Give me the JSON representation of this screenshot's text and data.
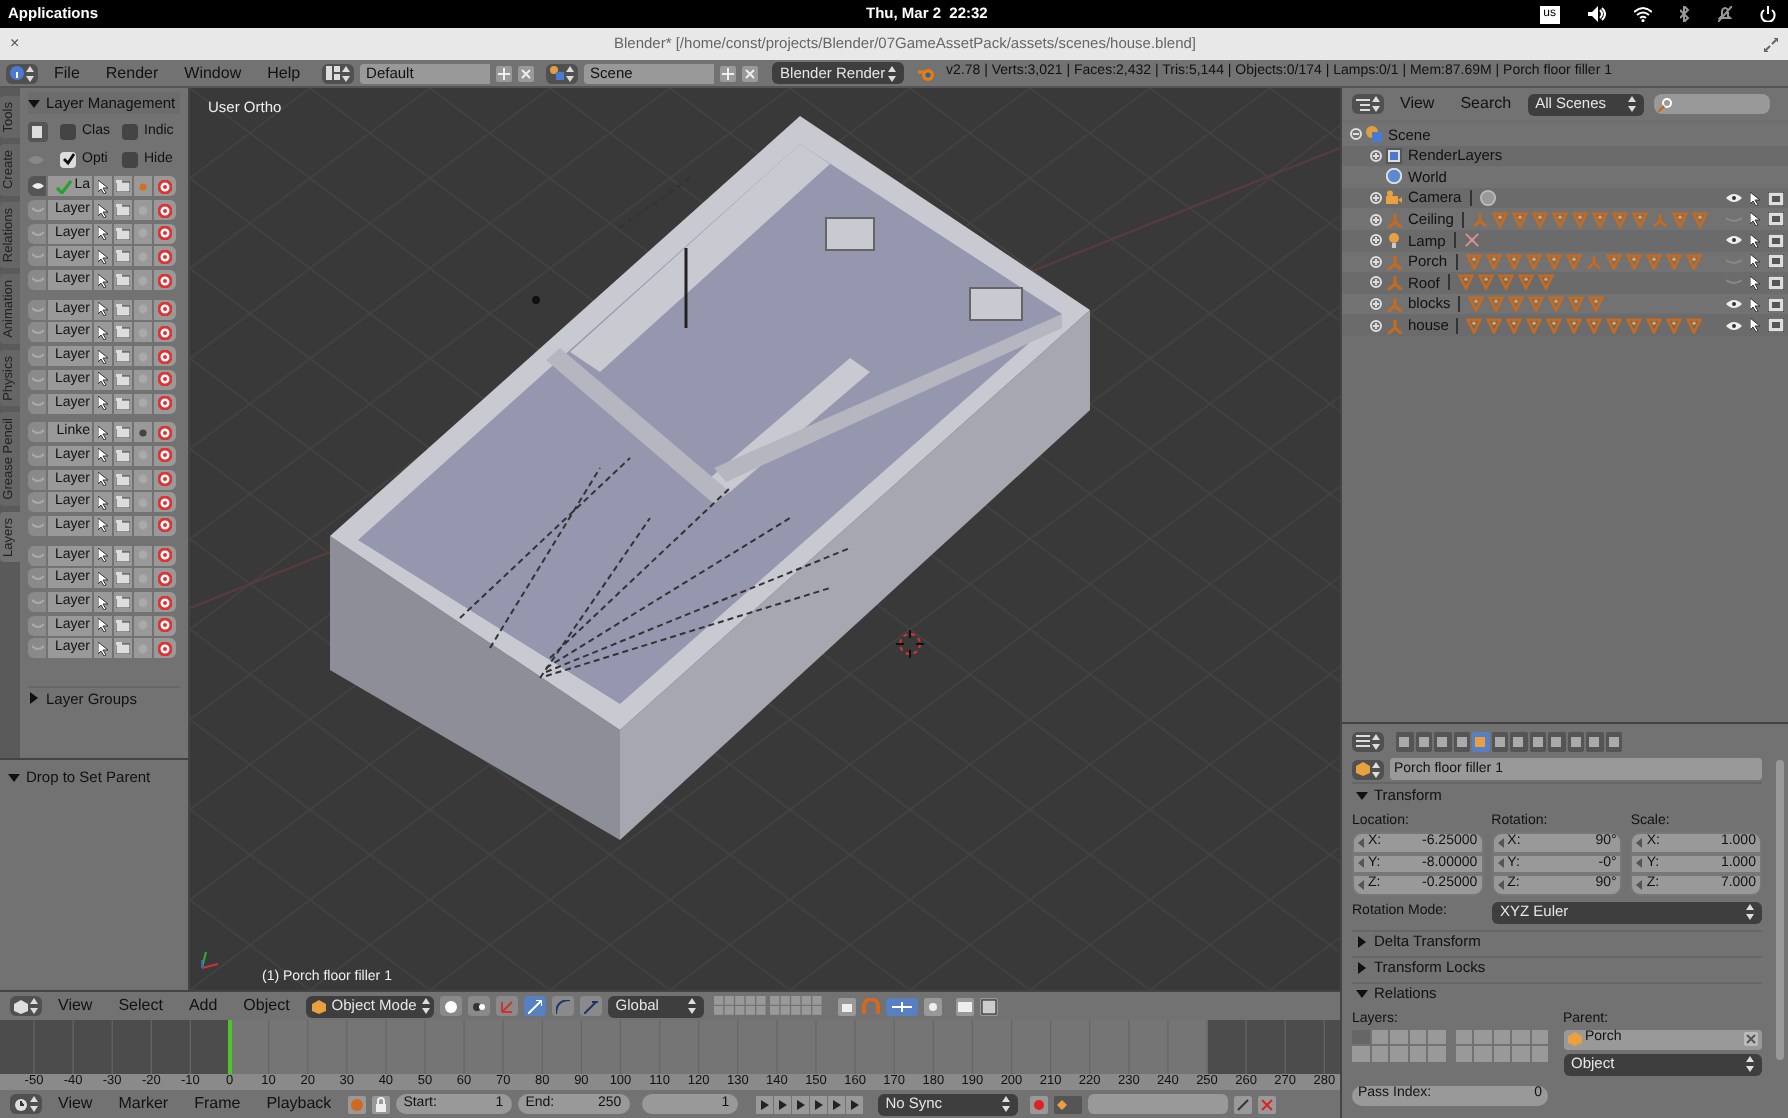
{
  "system_bar": {
    "menu": "Applications",
    "clock": "Thu, Mar 2  22:32",
    "keyboard": "us"
  },
  "window": {
    "close": "×",
    "title": "Blender* [/home/const/projects/Blender/07GameAssetPack/assets/scenes/house.blend]"
  },
  "info_header": {
    "menus": [
      "File",
      "Render",
      "Window",
      "Help"
    ],
    "screen": "Default",
    "scene": "Scene",
    "engine": "Blender Render",
    "stats": "v2.78 | Verts:3,021 | Faces:2,432 | Tris:5,144 | Objects:0/174 | Lamps:0/1 | Mem:87.69M | Porch floor filler 1"
  },
  "tool_tabs": [
    {
      "label": "Tools",
      "selected": false
    },
    {
      "label": "Create",
      "selected": false
    },
    {
      "label": "Relations",
      "selected": false
    },
    {
      "label": "Animation",
      "selected": false
    },
    {
      "label": "Physics",
      "selected": false
    },
    {
      "label": "Grease Pencil",
      "selected": false
    },
    {
      "label": "Layers",
      "selected": true
    }
  ],
  "layer_management": {
    "title": "Layer Management",
    "expanded": true,
    "toggles": [
      {
        "label": "Clas",
        "checked": false
      },
      {
        "label": "Indic",
        "checked": false
      },
      {
        "label": "Opti",
        "checked": true
      },
      {
        "label": "Hide",
        "checked": false
      }
    ],
    "groups": [
      [
        {
          "label": "La",
          "active": true,
          "marked": true
        },
        {
          "label": "Layer",
          "active": false,
          "marked": false
        },
        {
          "label": "Layer",
          "active": false,
          "marked": false
        },
        {
          "label": "Layer",
          "active": false,
          "marked": false
        },
        {
          "label": "Layer",
          "active": false,
          "marked": false
        }
      ],
      [
        {
          "label": "Layer",
          "active": false,
          "marked": false
        },
        {
          "label": "Layer",
          "active": false,
          "marked": false
        },
        {
          "label": "Layer",
          "active": false,
          "marked": false
        },
        {
          "label": "Layer",
          "active": false,
          "marked": false
        },
        {
          "label": "Layer",
          "active": false,
          "marked": false
        }
      ],
      [
        {
          "label": "Linke",
          "active": false,
          "marked": true
        },
        {
          "label": "Layer",
          "active": false,
          "marked": false
        },
        {
          "label": "Layer",
          "active": false,
          "marked": false
        },
        {
          "label": "Layer",
          "active": false,
          "marked": false
        },
        {
          "label": "Layer",
          "active": false,
          "marked": false
        }
      ],
      [
        {
          "label": "Layer",
          "active": false,
          "marked": false
        },
        {
          "label": "Layer",
          "active": false,
          "marked": false
        },
        {
          "label": "Layer",
          "active": false,
          "marked": false
        },
        {
          "label": "Layer",
          "active": false,
          "marked": false
        },
        {
          "label": "Layer",
          "active": false,
          "marked": false
        }
      ]
    ]
  },
  "layer_groups": {
    "title": "Layer Groups",
    "expanded": false
  },
  "drop_panel": {
    "title": "Drop to Set Parent",
    "expanded": true
  },
  "viewport": {
    "view_label": "User Ortho",
    "object_label": "(1) Porch floor filler 1"
  },
  "viewport_header": {
    "menus": [
      "View",
      "Select",
      "Add",
      "Object"
    ],
    "mode": "Object Mode",
    "orientation": "Global"
  },
  "timeline": {
    "ruler": [
      "-50",
      "-40",
      "-30",
      "-20",
      "-10",
      "0",
      "10",
      "20",
      "30",
      "40",
      "50",
      "60",
      "70",
      "80",
      "90",
      "100",
      "110",
      "120",
      "130",
      "140",
      "150",
      "160",
      "170",
      "180",
      "190",
      "200",
      "210",
      "220",
      "230",
      "240",
      "250",
      "260",
      "270",
      "280"
    ],
    "playhead": {
      "level": 0.152
    }
  },
  "timeline_header": {
    "menus": [
      "View",
      "Marker",
      "Frame",
      "Playback"
    ],
    "start_label": "Start:",
    "start": "1",
    "end_label": "End:",
    "end": "250",
    "frame": "1",
    "sync": "No Sync"
  },
  "outliner": {
    "menus": [
      "View",
      "Search"
    ],
    "filter": "All Scenes",
    "tree": [
      {
        "label": "Scene",
        "kind": "scene",
        "expanded": true,
        "children": [
          {
            "label": "RenderLayers",
            "kind": "renderlayers"
          },
          {
            "label": "World",
            "kind": "world"
          },
          {
            "label": "Camera",
            "kind": "camera",
            "visible": true,
            "data": [
              {
                "kind": "camera"
              }
            ]
          },
          {
            "label": "Ceiling",
            "kind": "empty",
            "visible": false,
            "data": [
              {
                "kind": "empty"
              },
              {
                "kind": "mesh"
              },
              {
                "kind": "mesh"
              },
              {
                "kind": "mesh"
              },
              {
                "kind": "mesh"
              },
              {
                "kind": "mesh"
              },
              {
                "kind": "mesh"
              },
              {
                "kind": "mesh"
              },
              {
                "kind": "mesh"
              },
              {
                "kind": "empty"
              },
              {
                "kind": "mesh"
              },
              {
                "kind": "mesh"
              }
            ]
          },
          {
            "label": "Lamp",
            "kind": "lamp",
            "visible": true,
            "data": [
              {
                "kind": "lamp"
              }
            ]
          },
          {
            "label": "Porch",
            "kind": "empty",
            "visible": false,
            "data": [
              {
                "kind": "mesh"
              },
              {
                "kind": "mesh"
              },
              {
                "kind": "mesh"
              },
              {
                "kind": "mesh"
              },
              {
                "kind": "mesh"
              },
              {
                "kind": "mesh"
              },
              {
                "kind": "empty"
              },
              {
                "kind": "mesh"
              },
              {
                "kind": "mesh"
              },
              {
                "kind": "mesh"
              },
              {
                "kind": "mesh"
              },
              {
                "kind": "mesh"
              }
            ]
          },
          {
            "label": "Roof",
            "kind": "empty",
            "visible": false,
            "data": [
              {
                "kind": "mesh"
              },
              {
                "kind": "mesh"
              },
              {
                "kind": "mesh"
              },
              {
                "kind": "mesh"
              },
              {
                "kind": "mesh"
              }
            ]
          },
          {
            "label": "blocks",
            "kind": "empty",
            "visible": true,
            "data": [
              {
                "kind": "mesh"
              },
              {
                "kind": "mesh"
              },
              {
                "kind": "mesh"
              },
              {
                "kind": "mesh"
              },
              {
                "kind": "mesh"
              },
              {
                "kind": "mesh"
              },
              {
                "kind": "mesh"
              }
            ]
          },
          {
            "label": "house",
            "kind": "empty",
            "visible": true,
            "data": [
              {
                "kind": "mesh"
              },
              {
                "kind": "mesh"
              },
              {
                "kind": "mesh"
              },
              {
                "kind": "mesh"
              },
              {
                "kind": "mesh"
              },
              {
                "kind": "mesh"
              },
              {
                "kind": "mesh"
              },
              {
                "kind": "mesh"
              },
              {
                "kind": "mesh"
              },
              {
                "kind": "mesh"
              },
              {
                "kind": "mesh"
              },
              {
                "kind": "mesh"
              }
            ]
          }
        ]
      }
    ]
  },
  "properties": {
    "context_tabs": [
      {
        "selected": false
      },
      {
        "selected": false
      },
      {
        "selected": false
      },
      {
        "selected": false
      },
      {
        "selected": true
      },
      {
        "selected": false
      },
      {
        "selected": false
      },
      {
        "selected": false
      },
      {
        "selected": false
      },
      {
        "selected": false
      },
      {
        "selected": false
      },
      {
        "selected": false
      }
    ],
    "object_name": "Porch floor filler 1",
    "panels": [
      {
        "title": "Transform",
        "kind": "transform",
        "expanded": true,
        "location_label": "Location:",
        "rotation_label": "Rotation:",
        "scale_label": "Scale:",
        "location": [
          {
            "axis": "X:",
            "value": "-6.25000"
          },
          {
            "axis": "Y:",
            "value": "-8.00000"
          },
          {
            "axis": "Z:",
            "value": "-0.25000"
          }
        ],
        "rotation": [
          {
            "axis": "X:",
            "value": "90°"
          },
          {
            "axis": "Y:",
            "value": "-0°"
          },
          {
            "axis": "Z:",
            "value": "90°"
          }
        ],
        "scale": [
          {
            "axis": "X:",
            "value": "1.000"
          },
          {
            "axis": "Y:",
            "value": "1.000"
          },
          {
            "axis": "Z:",
            "value": "7.000"
          }
        ],
        "rotation_mode_label": "Rotation Mode:",
        "rotation_mode": "XYZ Euler"
      },
      {
        "title": "Delta Transform",
        "expanded": false
      },
      {
        "title": "Transform Locks",
        "expanded": false
      },
      {
        "title": "Relations",
        "kind": "relations",
        "expanded": true,
        "layers_label": "Layers:",
        "parent_label": "Parent:",
        "parent": "Porch",
        "parent_type": "Object",
        "pass_index_label": "Pass Index:",
        "pass_index": "0",
        "layers": [
          {
            "on": true
          },
          {
            "on": false
          },
          {
            "on": false
          },
          {
            "on": false
          },
          {
            "on": false
          },
          {
            "on": false
          },
          {
            "on": false
          },
          {
            "on": false
          },
          {
            "on": false
          },
          {
            "on": false
          },
          {
            "on": false
          },
          {
            "on": false
          },
          {
            "on": false
          },
          {
            "on": false
          },
          {
            "on": false
          },
          {
            "on": false
          },
          {
            "on": false
          },
          {
            "on": false
          },
          {
            "on": false
          },
          {
            "on": false
          }
        ]
      }
    ]
  }
}
